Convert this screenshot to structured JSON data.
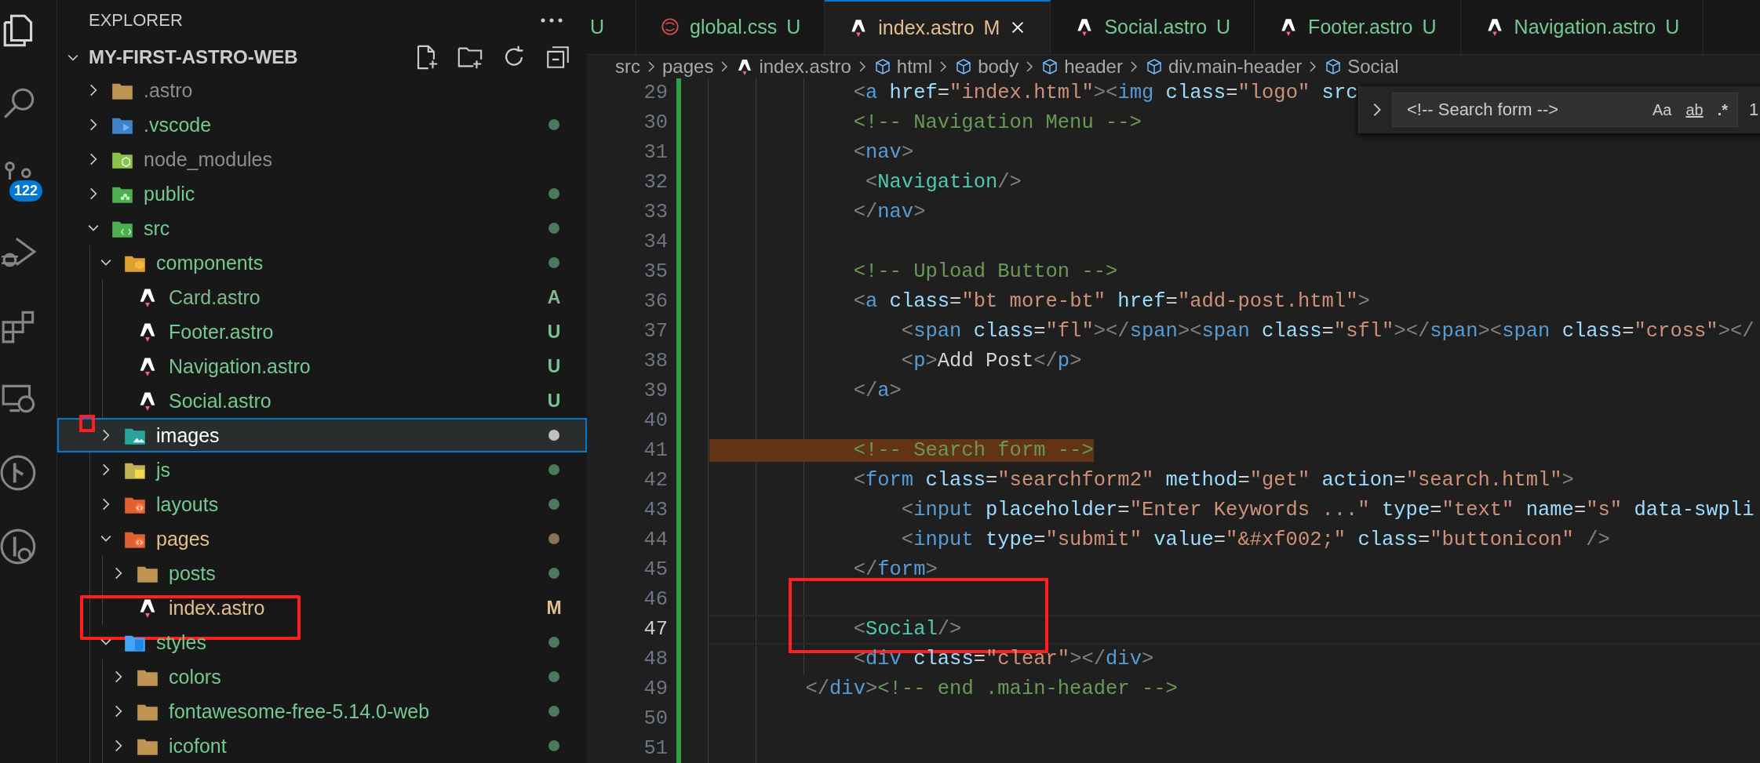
{
  "activity_bar": [
    {
      "selected": true
    },
    {
      "selected": false
    },
    {
      "selected": false,
      "badge": "122"
    },
    {
      "selected": false
    },
    {
      "selected": false
    },
    {
      "selected": false
    },
    {
      "selected": false
    },
    {
      "selected": false
    }
  ],
  "explorer": {
    "title": "EXPLORER",
    "project": "MY-FIRST-ASTRO-WEB",
    "tree": [
      {
        "name": ".astro",
        "kind": "folder",
        "expanded": false,
        "color": "#8c8c8c",
        "dot": false,
        "selected": false
      },
      {
        "name": ".vscode",
        "kind": "folder",
        "expanded": false,
        "color": "#73c991",
        "dot": true,
        "selected": false
      },
      {
        "name": "node_modules",
        "kind": "folder",
        "expanded": false,
        "color": "#8c8c8c",
        "dot": false,
        "selected": false
      },
      {
        "name": "public",
        "kind": "folder",
        "expanded": false,
        "color": "#73c991",
        "dot": true,
        "selected": false
      },
      {
        "name": "src",
        "kind": "folder",
        "expanded": true,
        "color": "#73c991",
        "dot": true,
        "selected": false,
        "children": [
          {
            "name": "components",
            "kind": "folder",
            "expanded": true,
            "color": "#73c991",
            "dot": true,
            "selected": false,
            "children": [
              {
                "name": "Card.astro",
                "kind": "file",
                "color": "#81b88b",
                "badge": "A",
                "selected": false
              },
              {
                "name": "Footer.astro",
                "kind": "file",
                "color": "#73c991",
                "badge": "U",
                "selected": false
              },
              {
                "name": "Navigation.astro",
                "kind": "file",
                "color": "#73c991",
                "badge": "U",
                "selected": false
              },
              {
                "name": "Social.astro",
                "kind": "file",
                "color": "#73c991",
                "badge": "U",
                "selected": false
              }
            ]
          },
          {
            "name": "images",
            "kind": "folder",
            "expanded": false,
            "dot": true,
            "selected": true,
            "marked": true
          },
          {
            "name": "js",
            "kind": "folder",
            "expanded": false,
            "color": "#73c991",
            "dot": true,
            "selected": false
          },
          {
            "name": "layouts",
            "kind": "folder",
            "expanded": false,
            "color": "#73c991",
            "dot": true,
            "selected": false
          },
          {
            "name": "pages",
            "kind": "folder",
            "expanded": true,
            "color": "#e2c08d",
            "dot": true,
            "selected": false,
            "children": [
              {
                "name": "posts",
                "kind": "folder",
                "expanded": false,
                "color": "#73c991",
                "dot": true,
                "selected": false
              },
              {
                "name": "index.astro",
                "kind": "file",
                "color": "#e2c08d",
                "badge": "M",
                "selected": false,
                "marked": true
              }
            ]
          },
          {
            "name": "styles",
            "kind": "folder",
            "expanded": true,
            "color": "#73c991",
            "dot": true,
            "selected": false,
            "children": [
              {
                "name": "colors",
                "kind": "folder",
                "expanded": false,
                "color": "#73c991",
                "dot": true,
                "selected": false
              },
              {
                "name": "fontawesome-free-5.14.0-web",
                "kind": "folder",
                "expanded": false,
                "color": "#73c991",
                "dot": true,
                "selected": false
              },
              {
                "name": "icofont",
                "kind": "folder",
                "expanded": false,
                "color": "#73c991",
                "dot": true,
                "selected": false
              }
            ]
          }
        ]
      }
    ]
  },
  "tabs": [
    {
      "color": "#73c991",
      "badge": "U",
      "selected": false
    },
    {
      "label": "global.css",
      "kind": "css",
      "color": "#73c991",
      "badge": "U",
      "selected": false
    },
    {
      "label": "index.astro",
      "kind": "astro",
      "color": "#e2c08d",
      "badge": "M",
      "selected": true
    },
    {
      "label": "Social.astro",
      "kind": "astro",
      "color": "#73c991",
      "badge": "U",
      "selected": false
    },
    {
      "label": "Footer.astro",
      "kind": "astro",
      "color": "#73c991",
      "badge": "U",
      "selected": false
    },
    {
      "label": "Navigation.astro",
      "kind": "astro",
      "color": "#73c991",
      "badge": "U",
      "selected": false
    }
  ],
  "breadcrumbs": [
    {
      "label": "src",
      "kind": "folder"
    },
    {
      "label": "pages",
      "kind": "folder"
    },
    {
      "label": "index.astro",
      "kind": "astro"
    },
    {
      "label": "html",
      "kind": "element"
    },
    {
      "label": "body",
      "kind": "element"
    },
    {
      "label": "header",
      "kind": "element"
    },
    {
      "label": "div.main-header",
      "kind": "element"
    },
    {
      "label": "Social",
      "kind": "element"
    }
  ],
  "find_widget": {
    "value": "<!-- Search form -->",
    "options": [
      {
        "label": "Aa",
        "kind": "case"
      },
      {
        "label": "ab",
        "kind": "word"
      },
      {
        "label": ".*",
        "kind": "regex"
      }
    ],
    "count": "1"
  },
  "lines": [
    {
      "number": "29",
      "text": "            <a href=\"index.html\"><img class=\"logo\" src",
      "changed": true,
      "current": false,
      "find_match": false
    },
    {
      "number": "30",
      "text": "            <!-- Navigation Menu -->",
      "changed": true,
      "current": false,
      "find_match": false
    },
    {
      "number": "31",
      "text": "            <nav>",
      "changed": true,
      "current": false,
      "find_match": false
    },
    {
      "number": "32",
      "text": "             <Navigation/>",
      "changed": true,
      "current": false,
      "find_match": false
    },
    {
      "number": "33",
      "text": "            </nav>",
      "changed": true,
      "current": false,
      "find_match": false
    },
    {
      "number": "34",
      "changed": true,
      "current": false
    },
    {
      "number": "35",
      "text": "            <!-- Upload Button -->",
      "changed": true,
      "current": false,
      "find_match": false
    },
    {
      "number": "36",
      "text": "            <a class=\"bt more-bt\" href=\"add-post.html\">",
      "changed": true,
      "current": false,
      "find_match": false
    },
    {
      "number": "37",
      "text": "                <span class=\"fl\"></span><span class=\"sfl\"></span><span class=\"cross\"></",
      "changed": true,
      "current": false,
      "find_match": false
    },
    {
      "number": "38",
      "text": "                <p>Add Post</p>",
      "changed": true,
      "current": false,
      "find_match": false
    },
    {
      "number": "39",
      "text": "            </a>",
      "changed": true,
      "current": false,
      "find_match": false
    },
    {
      "number": "40",
      "changed": true,
      "current": false
    },
    {
      "number": "41",
      "text": "            <!-- Search form -->",
      "changed": true,
      "current": false,
      "find_match": true
    },
    {
      "number": "42",
      "text": "            <form class=\"searchform2\" method=\"get\" action=\"search.html\">",
      "changed": true,
      "current": false,
      "find_match": false
    },
    {
      "number": "43",
      "text": "                <input placeholder=\"Enter Keywords ...\" type=\"text\" name=\"s\" data-swpli",
      "changed": true,
      "current": false,
      "find_match": false
    },
    {
      "number": "44",
      "text": "                <input type=\"submit\" value=\"&#xf002;\" class=\"buttonicon\" />",
      "changed": true,
      "current": false,
      "find_match": false
    },
    {
      "number": "45",
      "text": "            </form>",
      "changed": true,
      "current": false,
      "find_match": false
    },
    {
      "number": "46",
      "changed": true,
      "current": false
    },
    {
      "number": "47",
      "text": "            <Social/>",
      "changed": true,
      "current": true,
      "find_match": false,
      "marked": true
    },
    {
      "number": "48",
      "text": "            <div class=\"clear\"></div>",
      "changed": true,
      "current": false,
      "find_match": false
    },
    {
      "number": "49",
      "text": "        </div><!-- end .main-header -->",
      "changed": true,
      "current": false,
      "find_match": false
    },
    {
      "number": "50",
      "changed": true,
      "current": false
    },
    {
      "number": "51",
      "changed": true,
      "current": false
    }
  ]
}
